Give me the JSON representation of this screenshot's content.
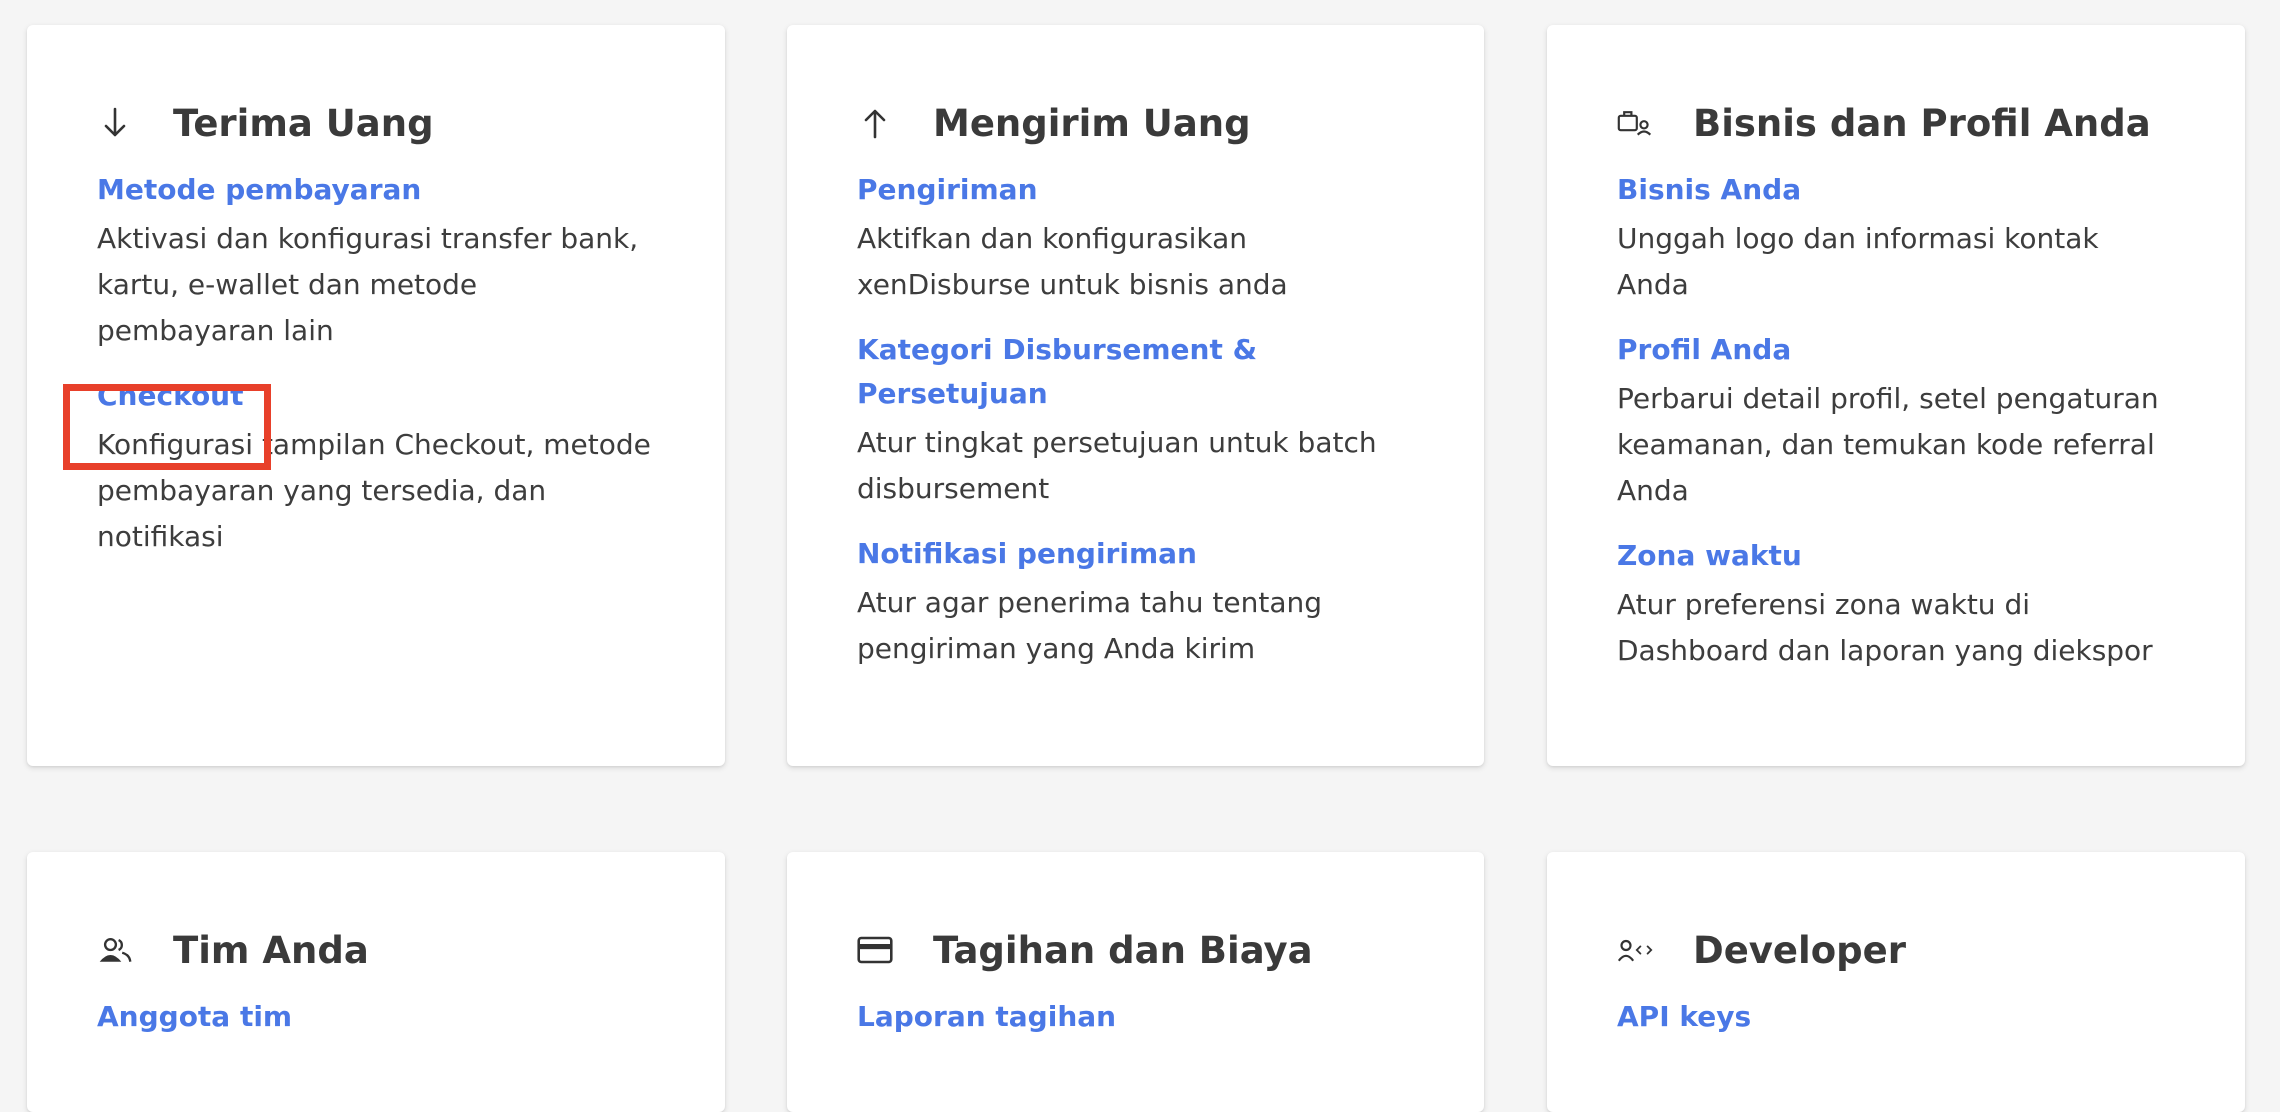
{
  "cards": [
    {
      "title": "Terima Uang",
      "icon": "arrow-down-icon",
      "items": [
        {
          "link": "Metode pembayaran",
          "desc": "Aktivasi dan konfigurasi transfer bank, kartu, e-wallet dan metode pembayaran lain"
        },
        {
          "link": "Checkout",
          "desc": "Konfigurasi tampilan Checkout, metode pembayaran yang tersedia, dan notifikasi"
        }
      ]
    },
    {
      "title": "Mengirim Uang",
      "icon": "arrow-up-icon",
      "items": [
        {
          "link": "Pengiriman",
          "desc": "Aktifkan dan konfigurasikan xenDisburse untuk bisnis anda"
        },
        {
          "link": "Kategori Disbursement & Persetujuan",
          "desc": "Atur tingkat persetujuan untuk batch disbursement"
        },
        {
          "link": "Notifikasi pengiriman",
          "desc": "Atur agar penerima tahu tentang pengiriman yang Anda kirim"
        }
      ]
    },
    {
      "title": "Bisnis dan Profil Anda",
      "icon": "business-profile-icon",
      "items": [
        {
          "link": "Bisnis Anda",
          "desc": "Unggah logo dan informasi kontak Anda"
        },
        {
          "link": "Profil Anda",
          "desc": "Perbarui detail profil, setel pengaturan keamanan, dan temukan kode referral Anda"
        },
        {
          "link": "Zona waktu",
          "desc": "Atur preferensi zona waktu di Dashboard dan laporan yang diekspor"
        }
      ]
    },
    {
      "title": "Tim Anda",
      "icon": "team-icon",
      "items": [
        {
          "link": "Anggota tim",
          "desc": ""
        }
      ]
    },
    {
      "title": "Tagihan dan Biaya",
      "icon": "credit-card-icon",
      "items": [
        {
          "link": "Laporan tagihan",
          "desc": ""
        }
      ]
    },
    {
      "title": "Developer",
      "icon": "developer-icon",
      "items": [
        {
          "link": "API keys",
          "desc": ""
        }
      ]
    }
  ],
  "colors": {
    "link": "#4a78e6",
    "title": "#3a3a3a",
    "text": "#3d3d3d",
    "highlight": "#e8402a",
    "background": "#f5f5f5"
  }
}
